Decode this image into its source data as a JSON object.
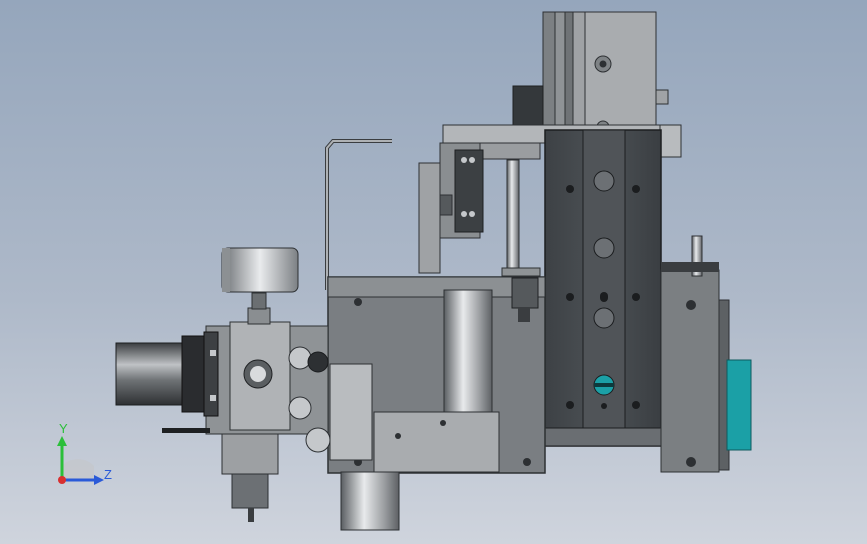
{
  "viewport": {
    "label": "",
    "background": [
      "#95a6bc",
      "#cfd4dd"
    ]
  },
  "model": {
    "part_color_dark": "#3e4347",
    "part_color_mid": "#707478",
    "part_color_light": "#b5b8bb",
    "accent_teal": "#1ba0a6"
  },
  "triad": {
    "x_label": "",
    "y_label": "Y",
    "z_label": "Z",
    "y_color": "#2bbf3a",
    "z_color": "#2a5ad8",
    "origin_color": "#d83030"
  }
}
